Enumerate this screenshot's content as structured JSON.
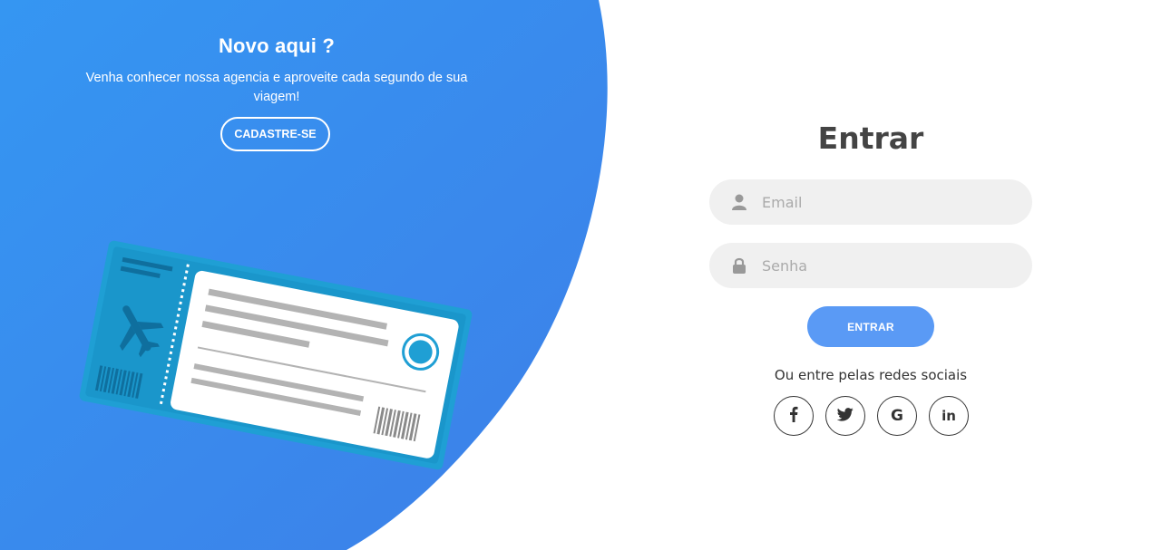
{
  "colors": {
    "gradient_start": "#3596f2",
    "gradient_end": "#3d7fe8",
    "accent_button": "#5a9af5",
    "field_bg": "#f0f0f0",
    "ticket_frame": "#1f9fd4",
    "heading_text": "#444444"
  },
  "left": {
    "title": "Novo aqui ?",
    "description": "Venha conhecer nossa agencia e aproveite cada segundo de sua viagem!",
    "signup_label": "CADASTRE-SE",
    "illustration": "plane-ticket-illustration"
  },
  "login": {
    "title": "Entrar",
    "email": {
      "icon": "user-icon",
      "placeholder": "Email",
      "value": ""
    },
    "password": {
      "icon": "lock-icon",
      "placeholder": "Senha",
      "value": ""
    },
    "submit_label": "ENTRAR",
    "social_text": "Ou entre pelas redes sociais",
    "social": [
      {
        "icon": "facebook-icon",
        "glyph": "f"
      },
      {
        "icon": "twitter-icon",
        "glyph": "🐦"
      },
      {
        "icon": "google-icon",
        "glyph": "G"
      },
      {
        "icon": "linkedin-icon",
        "glyph": "in"
      }
    ]
  }
}
